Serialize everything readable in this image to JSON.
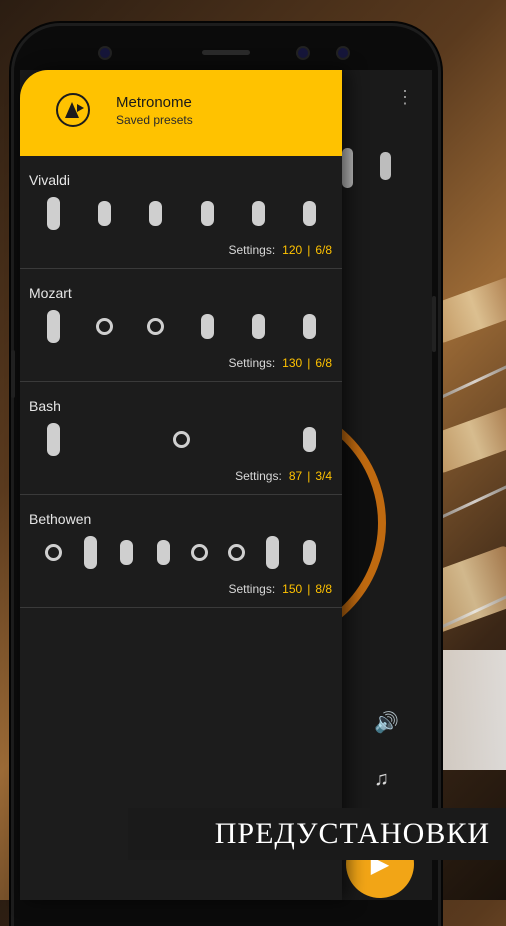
{
  "drawer": {
    "title": "Metronome",
    "subtitle": "Saved presets",
    "logo_icon": "metronome-icon"
  },
  "settings_label": "Settings:",
  "presets": [
    {
      "name": "Vivaldi",
      "tempo": "120",
      "signature": "6/8",
      "beats": [
        "accent",
        "normal",
        "normal",
        "normal",
        "normal",
        "normal"
      ]
    },
    {
      "name": "Mozart",
      "tempo": "130",
      "signature": "6/8",
      "beats": [
        "accent",
        "mute",
        "mute",
        "normal",
        "normal",
        "normal"
      ]
    },
    {
      "name": "Bash",
      "tempo": "87",
      "signature": "3/4",
      "beats": [
        "accent",
        "mute",
        "normal"
      ]
    },
    {
      "name": "Bethowen",
      "tempo": "150",
      "signature": "8/8",
      "beats": [
        "mute",
        "accent",
        "normal",
        "normal",
        "mute",
        "mute",
        "accent",
        "normal"
      ]
    }
  ],
  "background_screen": {
    "menu_icon": "kebab-menu-icon",
    "volume_icon": "volume-icon",
    "playlist_icon": "playlist-music-icon",
    "play_icon": "play-icon"
  },
  "caption": "ПРЕДУСТАНОВКИ",
  "colors": {
    "accent": "#ffc200",
    "drawer_bg": "#1c1c1c",
    "dial_ring": "#c06a10"
  }
}
